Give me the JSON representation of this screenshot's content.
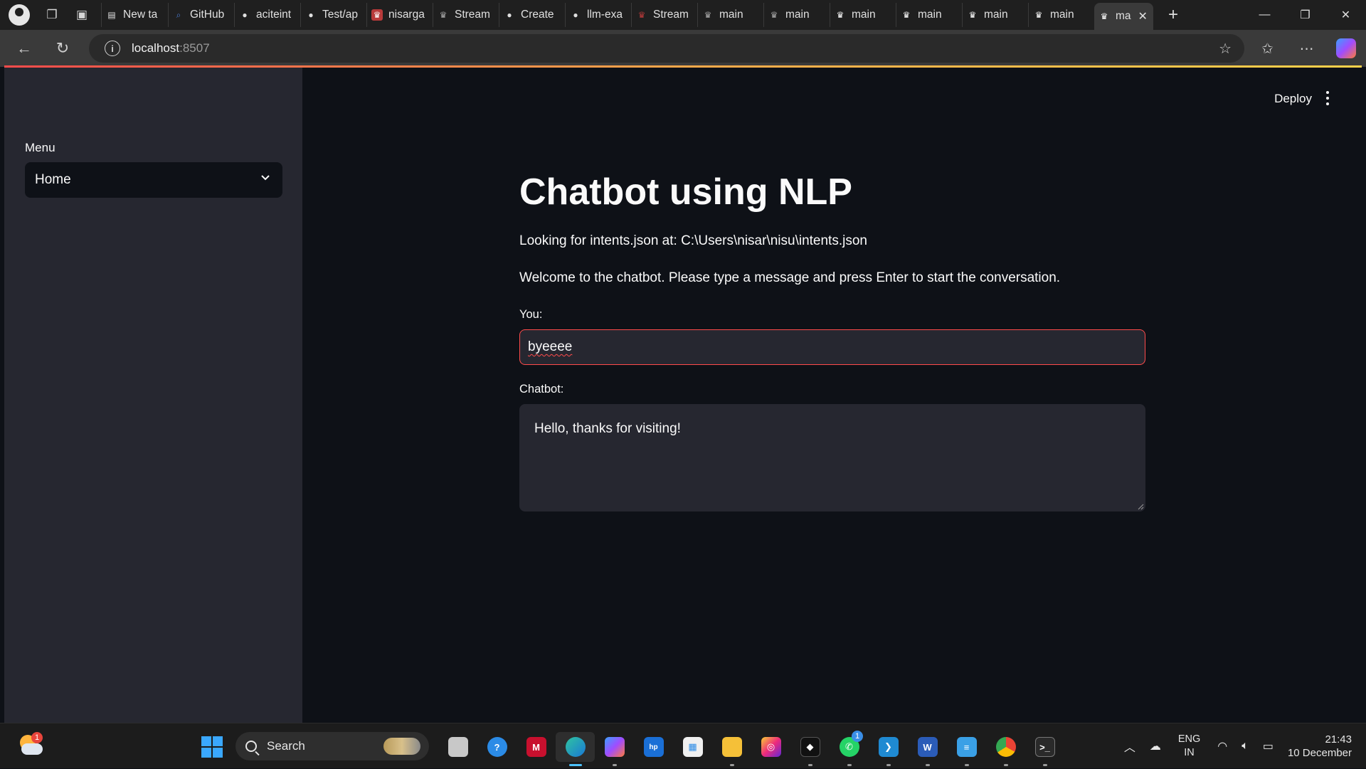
{
  "browser": {
    "tabs": [
      {
        "label": "New ta",
        "icon": "new-tab-page-icon"
      },
      {
        "label": "GitHub",
        "icon": "search-favicon"
      },
      {
        "label": "aciteint",
        "icon": "github-icon"
      },
      {
        "label": "Test/ap",
        "icon": "github-icon"
      },
      {
        "label": "nisarga",
        "icon": "streamlit-icon"
      },
      {
        "label": "Stream",
        "icon": "streamlit-icon"
      },
      {
        "label": "Create",
        "icon": "github-icon"
      },
      {
        "label": "llm-exa",
        "icon": "github-icon"
      },
      {
        "label": "Stream",
        "icon": "streamlit-icon"
      },
      {
        "label": "main",
        "icon": "streamlit-icon"
      },
      {
        "label": "main",
        "icon": "streamlit-icon"
      },
      {
        "label": "main",
        "icon": "streamlit-icon"
      },
      {
        "label": "main",
        "icon": "streamlit-icon"
      },
      {
        "label": "main",
        "icon": "streamlit-icon"
      },
      {
        "label": "main",
        "icon": "streamlit-icon"
      }
    ],
    "active_tab": {
      "label": "ma",
      "icon": "streamlit-icon"
    },
    "url_host": "localhost",
    "url_port": ":8507"
  },
  "app": {
    "sidebar": {
      "menu_label": "Menu",
      "select_value": "Home"
    },
    "header": {
      "deploy_label": "Deploy"
    },
    "title": "Chatbot using NLP",
    "intents_path_text": "Looking for intents.json at: C:\\Users\\nisar\\nisu\\intents.json",
    "welcome_text": "Welcome to the chatbot. Please type a message and press Enter to start the conversation.",
    "user_input_label": "You:",
    "user_input_value": "byeeee",
    "chatbot_label": "Chatbot:",
    "chatbot_response": "Hello, thanks for visiting!"
  },
  "taskbar": {
    "weather_badge": "1",
    "search_label": "Search",
    "whatsapp_badge": "1",
    "language_line1": "ENG",
    "language_line2": "IN",
    "time": "21:43",
    "date": "10 December"
  },
  "colors": {
    "app_background": "#0e1117",
    "sidebar_background": "#262730",
    "accent_red": "#ff4b4b"
  }
}
